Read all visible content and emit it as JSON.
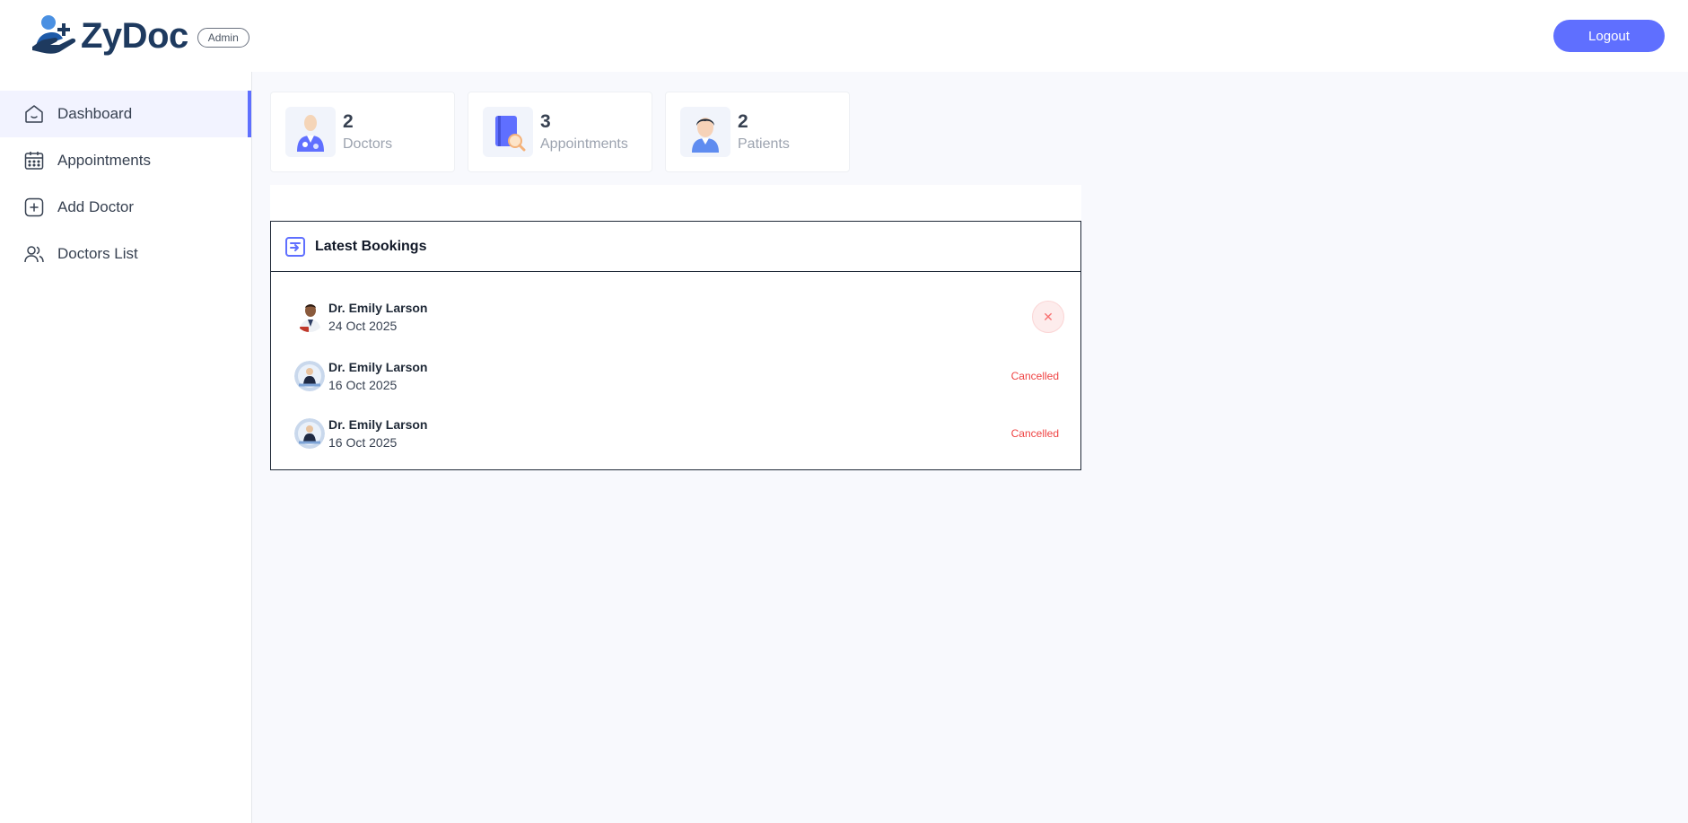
{
  "app": {
    "brand_name": "ZyDoc",
    "role_badge": "Admin",
    "logout_label": "Logout",
    "accent_color": "#5f6fff"
  },
  "sidebar": {
    "items": [
      {
        "label": "Dashboard",
        "icon": "home-icon",
        "active": true
      },
      {
        "label": "Appointments",
        "icon": "calendar-icon",
        "active": false
      },
      {
        "label": "Add Doctor",
        "icon": "plus-square-icon",
        "active": false
      },
      {
        "label": "Doctors List",
        "icon": "people-icon",
        "active": false
      }
    ]
  },
  "stats": [
    {
      "value": "2",
      "label": "Doctors",
      "icon": "doctor-icon"
    },
    {
      "value": "3",
      "label": "Appointments",
      "icon": "appointment-book-icon"
    },
    {
      "value": "2",
      "label": "Patients",
      "icon": "patient-icon"
    }
  ],
  "latest_bookings": {
    "title": "Latest Bookings",
    "items": [
      {
        "doctor": "Dr. Emily Larson",
        "date": "24 Oct 2025",
        "status": "",
        "action": "cancel"
      },
      {
        "doctor": "Dr. Emily Larson",
        "date": "16 Oct 2025",
        "status": "Cancelled"
      },
      {
        "doctor": "Dr. Emily Larson",
        "date": "16 Oct 2025",
        "status": "Cancelled"
      }
    ]
  },
  "cancel_symbol": "✕"
}
